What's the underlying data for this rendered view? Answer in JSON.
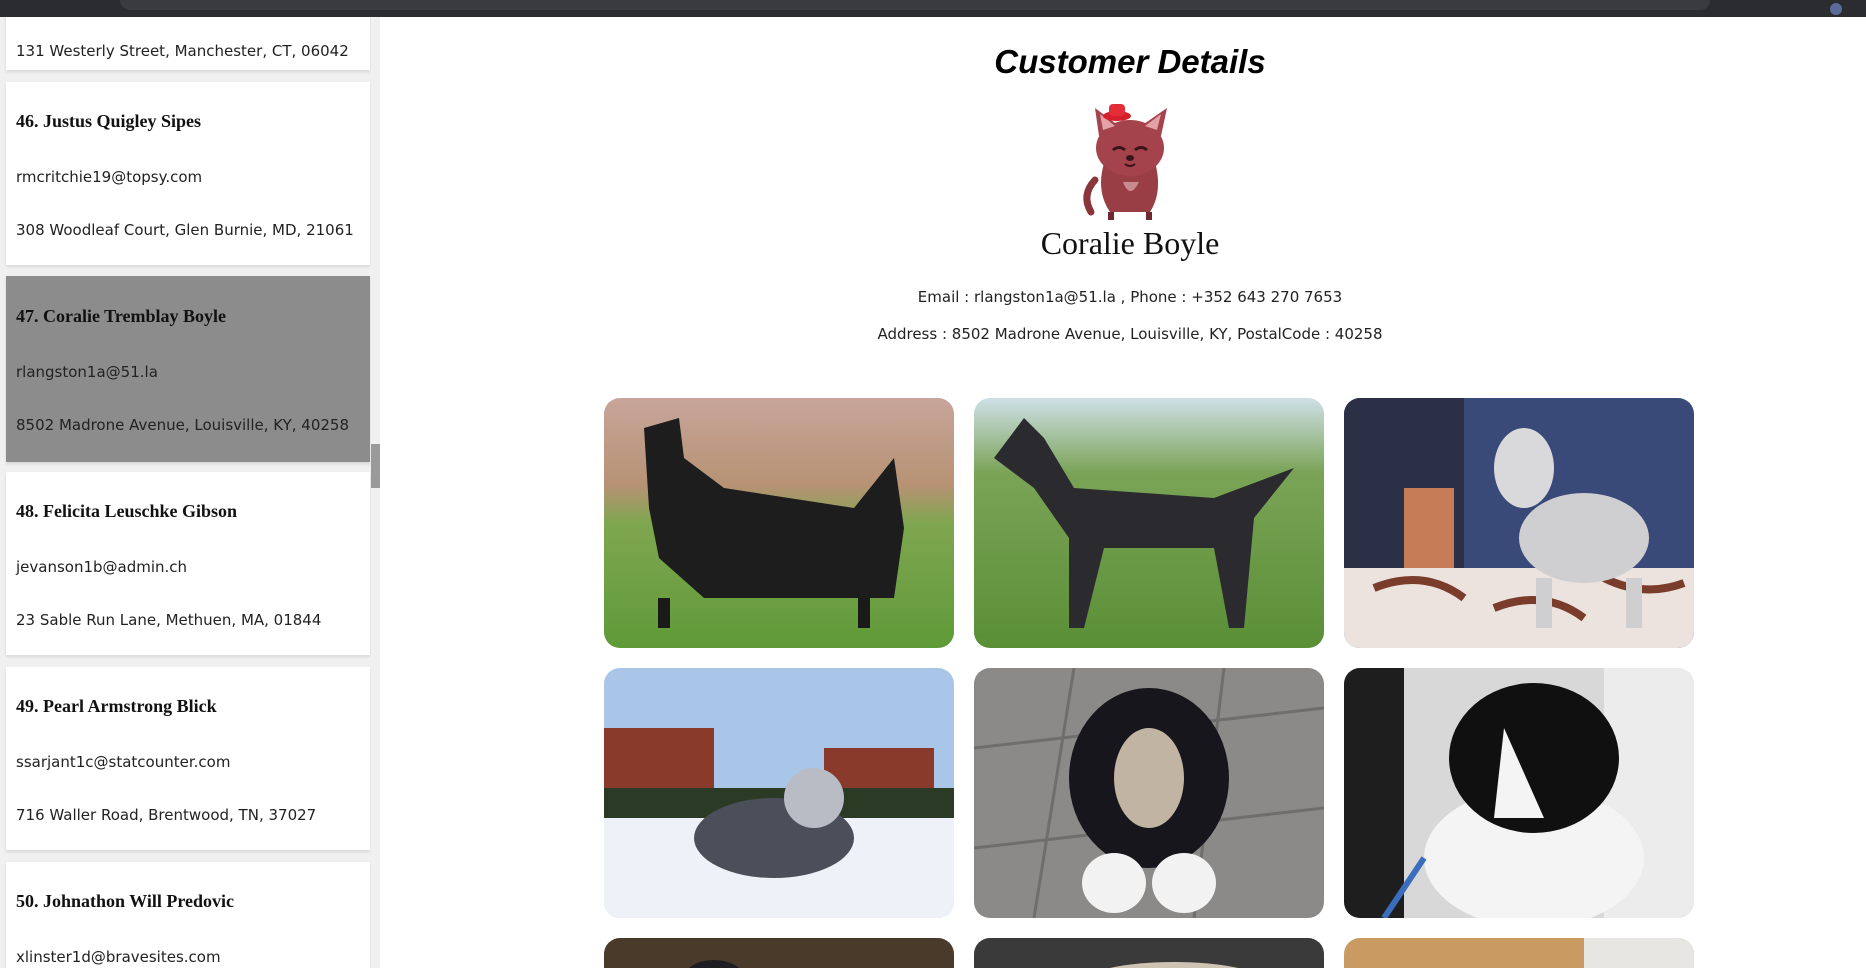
{
  "sidebar": {
    "customers": [
      {
        "name": "",
        "email": "",
        "address": "131 Westerly Street, Manchester, CT, 06042"
      },
      {
        "name": "46. Justus Quigley Sipes",
        "email": "rmcritchie19@topsy.com",
        "address": "308 Woodleaf Court, Glen Burnie, MD, 21061"
      },
      {
        "name": "47. Coralie Tremblay Boyle",
        "email": "rlangston1a@51.la",
        "address": "8502 Madrone Avenue, Louisville, KY, 40258"
      },
      {
        "name": "48. Felicita Leuschke Gibson",
        "email": "jevanson1b@admin.ch",
        "address": "23 Sable Run Lane, Methuen, MA, 01844"
      },
      {
        "name": "49. Pearl Armstrong Blick",
        "email": "ssarjant1c@statcounter.com",
        "address": "716 Waller Road, Brentwood, TN, 37027"
      },
      {
        "name": "50. Johnathon Will Predovic",
        "email": "xlinster1d@bravesites.com",
        "address": ""
      }
    ]
  },
  "details": {
    "title": "Customer Details",
    "avatar_icon": "cat-with-hat-icon",
    "name": "Coralie Boyle",
    "contact": "Email : rlangston1a@51.la , Phone : +352 643 270 7653",
    "address": "Address : 8502 Madrone Avenue, Louisville, KY, PostalCode : 40258"
  },
  "gallery": [
    "scottish-terrier-photo",
    "hairless-dog-photo",
    "bedlington-terrier-photo",
    "bearded-collie-snow-photo",
    "bearded-collie-tile-photo",
    "border-collie-photo",
    "dog-photo-7",
    "dog-photo-8",
    "dog-photo-9"
  ]
}
